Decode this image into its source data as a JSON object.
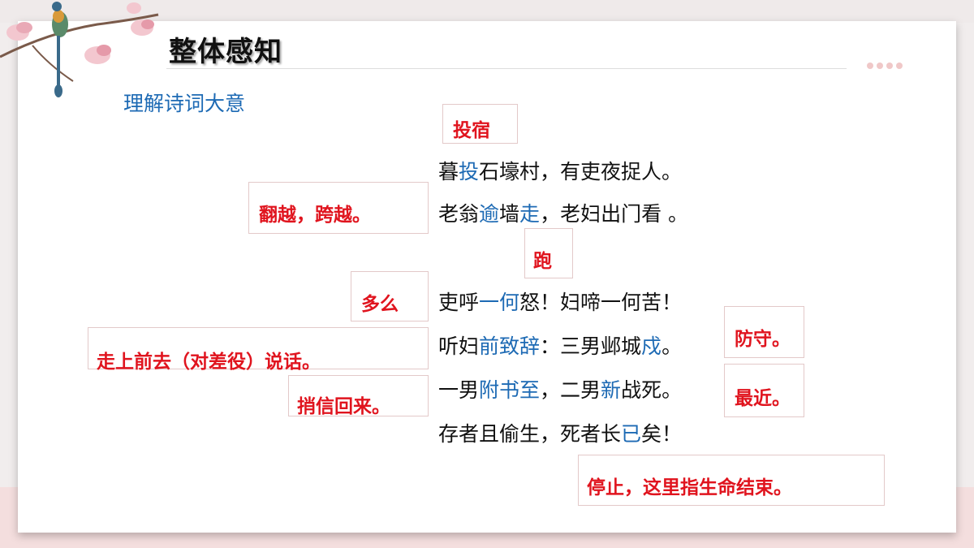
{
  "header": {
    "title": "整体感知",
    "subtitle": "理解诗词大意"
  },
  "poem": [
    {
      "segments": [
        {
          "t": "暮",
          "hl": false
        },
        {
          "t": "投",
          "hl": true
        },
        {
          "t": "石壕村，有吏夜捉人。",
          "hl": false
        }
      ]
    },
    {
      "segments": [
        {
          "t": "老翁",
          "hl": false
        },
        {
          "t": "逾",
          "hl": true
        },
        {
          "t": "墙",
          "hl": false
        },
        {
          "t": "走",
          "hl": true
        },
        {
          "t": "，老妇出门看 。",
          "hl": false
        }
      ]
    },
    {
      "segments": [
        {
          "t": "吏呼",
          "hl": false
        },
        {
          "t": "一何",
          "hl": true
        },
        {
          "t": "怒！妇啼一何苦！",
          "hl": false
        }
      ]
    },
    {
      "segments": [
        {
          "t": "听妇",
          "hl": false
        },
        {
          "t": "前致辞",
          "hl": true
        },
        {
          "t": "：三男邺城",
          "hl": false
        },
        {
          "t": "戍",
          "hl": true
        },
        {
          "t": "。",
          "hl": false
        }
      ]
    },
    {
      "segments": [
        {
          "t": "一男",
          "hl": false
        },
        {
          "t": "附书至",
          "hl": true
        },
        {
          "t": "，二男",
          "hl": false
        },
        {
          "t": "新",
          "hl": true
        },
        {
          "t": "战死。",
          "hl": false
        }
      ]
    },
    {
      "segments": [
        {
          "t": "存者且偷生，死者长",
          "hl": false
        },
        {
          "t": "已",
          "hl": true
        },
        {
          "t": "矣！",
          "hl": false
        }
      ]
    }
  ],
  "notes": {
    "tou": "投宿",
    "yu": "翻越，跨越。",
    "zou": "跑",
    "yihe": "多么",
    "qianzhici": "走上前去（对差役）说话。",
    "shu": "防守。",
    "fushuzhi": "捎信回来。",
    "xin": "最近。",
    "yi": "停止，这里指生命结束。"
  },
  "colors": {
    "highlight": "#1d6ab4",
    "note": "#e0141e"
  }
}
